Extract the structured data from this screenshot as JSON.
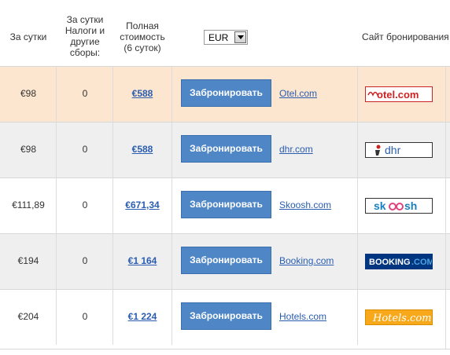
{
  "header": {
    "per_day": "За сутки",
    "taxes": "За сутки Налоги и другие сборы:",
    "taxes_lines": [
      "За сутки",
      "Налоги и",
      "другие",
      "сборы:"
    ],
    "total_lines": [
      "Полная",
      "стоимость",
      "(6 суток)"
    ],
    "currency": "EUR",
    "site": "Сайт бронирования"
  },
  "book_label": "Забронировать",
  "rows": [
    {
      "price": "€98",
      "tax": "0",
      "total": "€588",
      "site": "Otel.com",
      "logo": "otel-logo",
      "logo_text": "otel.com"
    },
    {
      "price": "€98",
      "tax": "0",
      "total": "€588",
      "site": "dhr.com",
      "logo": "dhr-logo",
      "logo_text": "dhr"
    },
    {
      "price": "€111,89",
      "tax": "0",
      "total": "€671,34",
      "site": "Skoosh.com",
      "logo": "skoosh-logo",
      "logo_text": "skoosh"
    },
    {
      "price": "€194",
      "tax": "0",
      "total": "€1 164",
      "site": "Booking.com",
      "logo": "booking-logo",
      "logo_text": "BOOKING.COM"
    },
    {
      "price": "€204",
      "tax": "0",
      "total": "€1 224",
      "site": "Hotels.com",
      "logo": "hotels-logo",
      "logo_text": "Hotels.com"
    }
  ],
  "colors": {
    "highlight_row": "#fde6cf",
    "grey_row": "#efefef",
    "button": "#4f86c6",
    "link": "#2a5db0"
  }
}
